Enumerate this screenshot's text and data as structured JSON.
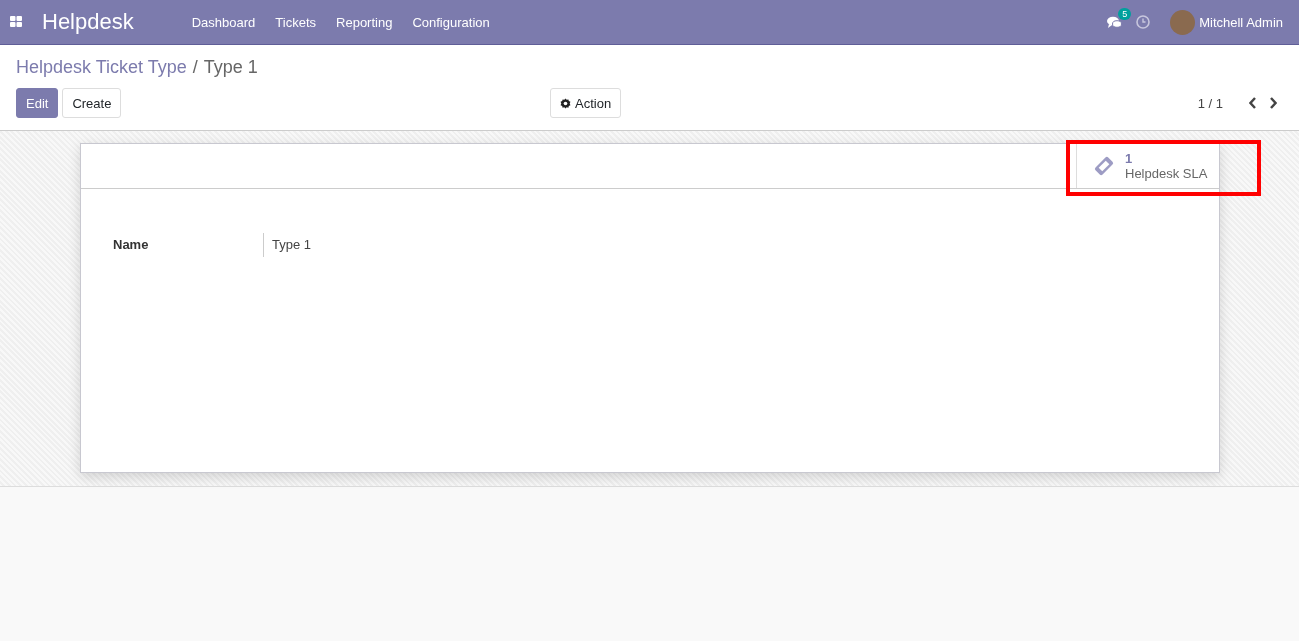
{
  "navbar": {
    "app_title": "Helpdesk",
    "menu": [
      "Dashboard",
      "Tickets",
      "Reporting",
      "Configuration"
    ],
    "messages_badge": "5",
    "user_name": "Mitchell Admin"
  },
  "breadcrumb": {
    "parent": "Helpdesk Ticket Type",
    "separator": "/",
    "current": "Type 1"
  },
  "buttons": [
    {
      "label": "Edit",
      "kind": "primary"
    },
    {
      "label": "Create",
      "kind": "secondary"
    }
  ],
  "action_button": {
    "label": "Action"
  },
  "pager": {
    "value": "1 / 1"
  },
  "smart_button": {
    "count": "1",
    "label": "Helpdesk SLA",
    "highlighted": true
  },
  "fields": [
    {
      "label": "Name",
      "value": "Type 1"
    }
  ]
}
